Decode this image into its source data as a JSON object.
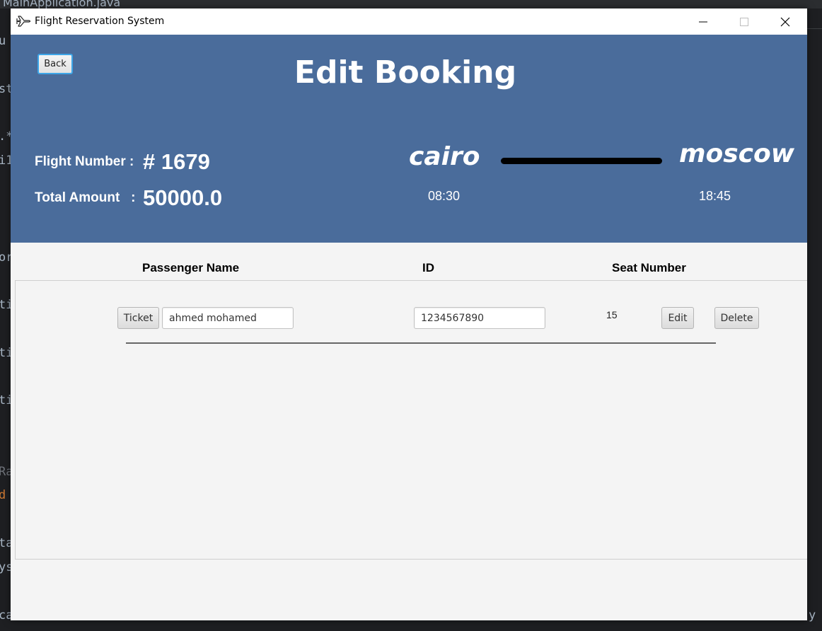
{
  "ide": {
    "tab_label": "MainApplication.java",
    "fragments": [
      "u",
      "st",
      ".*",
      "i1",
      "or",
      "ti",
      "ti",
      "ti",
      "Ra",
      "d",
      "ta",
      "ys",
      "ca",
      "().",
      "y"
    ]
  },
  "window": {
    "title": "Flight Reservation System",
    "app_icon": "airplane-icon"
  },
  "header": {
    "back_label": "Back",
    "title": "Edit Booking",
    "flight_number_label": "Flight Number :",
    "flight_number_value": "# 1679",
    "total_amount_label": "Total Amount   :",
    "total_amount_value": "50000.0",
    "origin_city": "cairo",
    "destination_city": "moscow",
    "departure_time": "08:30",
    "arrival_time": "18:45",
    "background_color": "#4a6c9b"
  },
  "table": {
    "columns": [
      "Passenger Name",
      "ID",
      "Seat Number"
    ],
    "rows": [
      {
        "ticket_label": "Ticket",
        "passenger_name": "ahmed mohamed",
        "passenger_id": "1234567890",
        "seat_number": "15",
        "edit_label": "Edit",
        "delete_label": "Delete"
      }
    ]
  }
}
